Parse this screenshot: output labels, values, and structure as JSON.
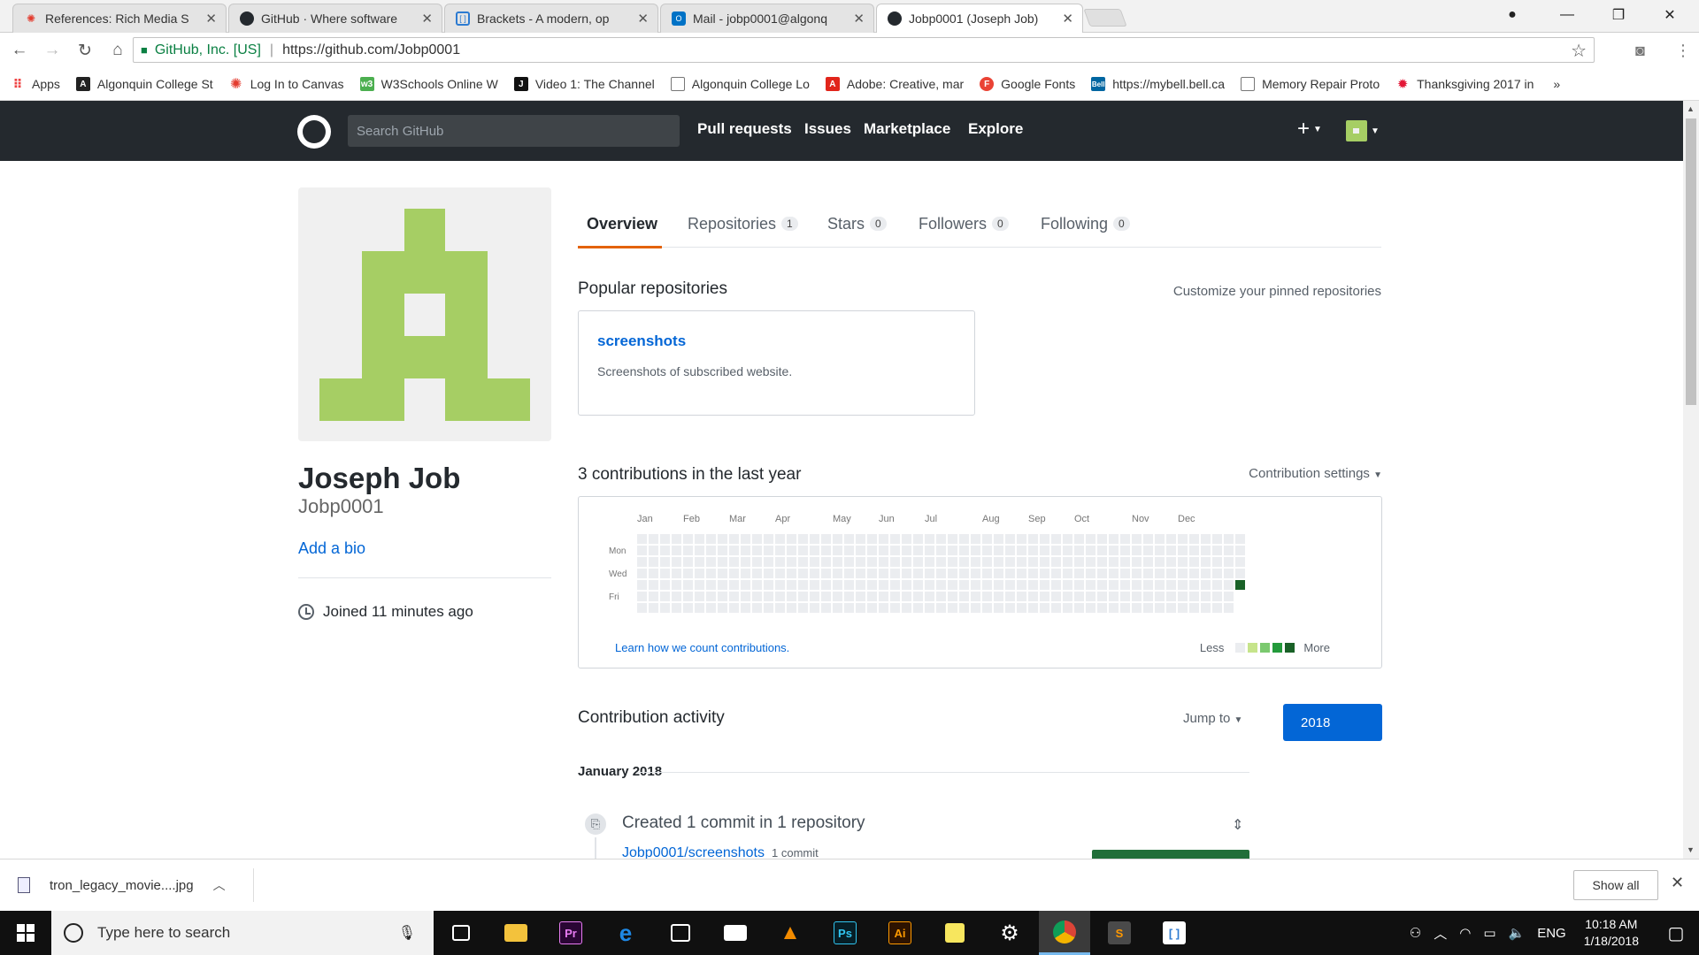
{
  "browser": {
    "tabs": [
      {
        "title": "References: Rich Media S",
        "icon": "canvas-icon",
        "color": "#e33b2e"
      },
      {
        "title": "GitHub · Where software",
        "icon": "github-icon",
        "color": "#24292e"
      },
      {
        "title": "Brackets - A modern, op",
        "icon": "brackets-icon",
        "color": "#2d7bd1"
      },
      {
        "title": "Mail - jobp0001@algonq",
        "icon": "outlook-icon",
        "color": "#0072c6"
      },
      {
        "title": "Jobp0001 (Joseph Job)",
        "icon": "github-icon",
        "color": "#24292e"
      }
    ],
    "address": {
      "org": "GitHub, Inc. [US]",
      "url": "https://github.com/Jobp0001"
    },
    "bookmarks": [
      {
        "label": "Apps",
        "icon": "apps-grid-icon",
        "color": "#e44"
      },
      {
        "label": "Algonquin College St",
        "icon": "algonquin-icon",
        "color": "#222"
      },
      {
        "label": "Log In to Canvas",
        "icon": "canvas-icon",
        "color": "#e33b2e"
      },
      {
        "label": "W3Schools Online W",
        "icon": "w3schools-icon",
        "color": "#4caf50"
      },
      {
        "label": "Video 1: The Channel",
        "icon": "video-icon",
        "color": "#111"
      },
      {
        "label": "Algonquin College Lo",
        "icon": "page-icon",
        "color": "#fff"
      },
      {
        "label": "Adobe: Creative, mar",
        "icon": "adobe-icon",
        "color": "#e1251b"
      },
      {
        "label": "Google Fonts",
        "icon": "google-fonts-icon",
        "color": "#ea4335"
      },
      {
        "label": "https://mybell.bell.ca",
        "icon": "bell-icon",
        "color": "#0066a1"
      },
      {
        "label": "Memory Repair Proto",
        "icon": "page-icon",
        "color": "#fff"
      },
      {
        "label": "Thanksgiving 2017 in",
        "icon": "cbc-icon",
        "color": "#e31837"
      }
    ]
  },
  "github": {
    "search_placeholder": "Search GitHub",
    "nav": [
      "Pull requests",
      "Issues",
      "Marketplace",
      "Explore"
    ],
    "plus": "+"
  },
  "profile": {
    "name": "Joseph Job",
    "username": "Jobp0001",
    "bio_link": "Add a bio",
    "joined": "Joined 11 minutes ago",
    "avatar_color": "#a6ce64"
  },
  "tabs": [
    {
      "label": "Overview",
      "count": null
    },
    {
      "label": "Repositories",
      "count": "1"
    },
    {
      "label": "Stars",
      "count": "0"
    },
    {
      "label": "Followers",
      "count": "0"
    },
    {
      "label": "Following",
      "count": "0"
    }
  ],
  "popular": {
    "title": "Popular repositories",
    "customize": "Customize your pinned repositories",
    "repo": {
      "name": "screenshots",
      "description": "Screenshots of subscribed website."
    }
  },
  "contributions": {
    "title": "3 contributions in the last year",
    "settings": "Contribution settings",
    "months": [
      "Jan",
      "Feb",
      "Mar",
      "Apr",
      "May",
      "Jun",
      "Jul",
      "Aug",
      "Sep",
      "Oct",
      "Nov",
      "Dec"
    ],
    "days": [
      "Mon",
      "Wed",
      "Fri"
    ],
    "learn": "Learn how we count contributions.",
    "less": "Less",
    "more": "More",
    "colors": [
      "#ebedf0",
      "#c6e48b",
      "#7bc96f",
      "#239a3b",
      "#196127"
    ]
  },
  "activity": {
    "title": "Contribution activity",
    "jump": "Jump to",
    "year": "2018",
    "month": "January 2018",
    "summary": "Created 1 commit in 1 repository",
    "repo": "Jobp0001/screenshots",
    "commits": "1 commit"
  },
  "download": {
    "file": "tron_legacy_movie....jpg",
    "show_all": "Show all"
  },
  "taskbar": {
    "search_placeholder": "Type here to search",
    "time": "10:18 AM",
    "date": "1/18/2018",
    "lang": "ENG"
  }
}
